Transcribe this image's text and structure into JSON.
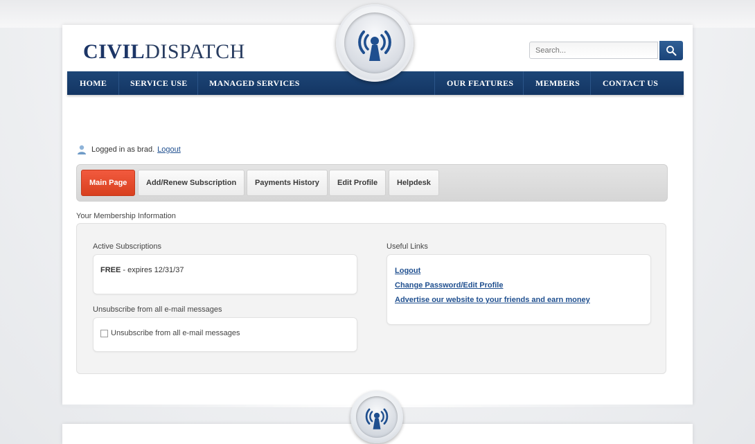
{
  "header": {
    "logo_bold": "CIVIL",
    "logo_regular": "DISPATCH",
    "search_placeholder": "Search..."
  },
  "nav": {
    "items": [
      "HOME",
      "SERVICE USE",
      "MANAGED SERVICES",
      "OUR FEATURES",
      "MEMBERS",
      "CONTACT US"
    ]
  },
  "session": {
    "status_text": "Logged in as brad.",
    "logout_label": "Logout"
  },
  "tabs": [
    "Main Page",
    "Add/Renew Subscription",
    "Payments History",
    "Edit Profile",
    "Helpdesk"
  ],
  "membership": {
    "section_title": "Your Membership Information",
    "active_subscriptions_title": "Active Subscriptions",
    "plan_name": "FREE",
    "plan_expiry": " - expires 12/31/37",
    "unsubscribe_title": "Unsubscribe from all e-mail messages",
    "unsubscribe_checkbox_label": "Unsubscribe from all e-mail messages",
    "useful_links_title": "Useful Links",
    "useful_links": [
      "Logout",
      "Change Password/Edit Profile",
      "Advertise our website to your friends and earn money"
    ]
  },
  "colors": {
    "nav_blue": "#1d4677",
    "logo_navy": "#1c3566",
    "active_tab": "#e64b2c",
    "link_blue": "#1f4f8f"
  }
}
